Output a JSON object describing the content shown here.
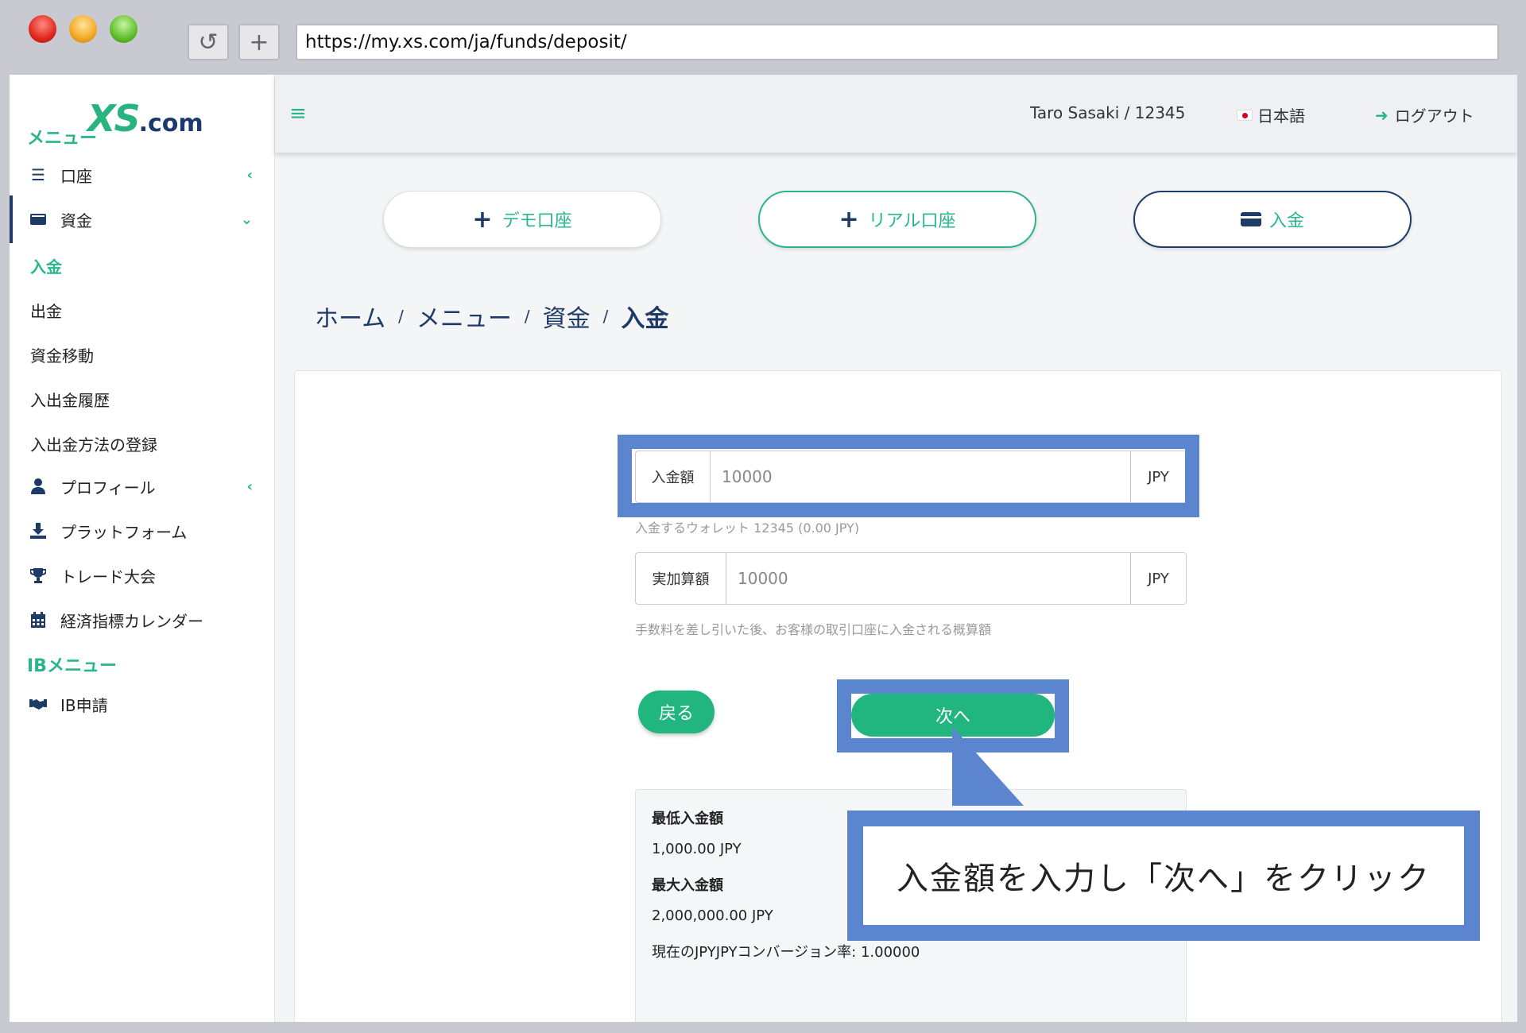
{
  "browser": {
    "url": "https://my.xs.com/ja/funds/deposit/",
    "reload_label": "↺",
    "newtab_label": "+"
  },
  "logo": {
    "xs": "XS",
    "com": ".com"
  },
  "sidebar": {
    "menu_heading": "メニュー",
    "items": [
      {
        "label": "口座",
        "icon": "list-icon"
      },
      {
        "label": "資金",
        "icon": "wallet-icon"
      },
      {
        "label": "プロフィール",
        "icon": "user-icon"
      },
      {
        "label": "プラットフォーム",
        "icon": "download-icon"
      },
      {
        "label": "トレード大会",
        "icon": "trophy-icon"
      },
      {
        "label": "経済指標カレンダー",
        "icon": "calendar-icon"
      }
    ],
    "funds_sub": [
      "入金",
      "出金",
      "資金移動",
      "入出金履歴",
      "入出金方法の登録"
    ],
    "ib_heading": "IBメニュー",
    "ib_items": [
      {
        "label": "IB申請",
        "icon": "handshake-icon"
      }
    ]
  },
  "header": {
    "menu_icon": "hamburger-icon",
    "user": "Taro Sasaki / 12345",
    "language": "日本語",
    "logout": "ログアウト"
  },
  "actions": {
    "demo": "デモ口座",
    "real": "リアル口座",
    "deposit": "入金"
  },
  "breadcrumb": [
    "ホーム",
    "メニュー",
    "資金",
    "入金"
  ],
  "form": {
    "amount_label": "入金額",
    "amount_value": "10000",
    "amount_unit": "JPY",
    "amount_hint": "入金するウォレット 12345 (0.00 JPY)",
    "actual_label": "実加算額",
    "actual_value": "10000",
    "actual_unit": "JPY",
    "actual_hint": "手数料を差し引いた後、お客様の取引口座に入金される概算額",
    "back_label": "戻る",
    "next_label": "次へ"
  },
  "limits": {
    "min_title": "最低入金額",
    "min_value": "1,000.00 JPY",
    "max_title": "最大入金額",
    "max_value": "2,000,000.00 JPY",
    "rate": "現在のJPYJPYコンバージョン率: 1.00000"
  },
  "callout": {
    "text": "入金額を入力し「次へ」をクリック"
  },
  "colors": {
    "accent": "#2bb58c",
    "navy": "#1e3a66",
    "highlight": "#5b86cf",
    "button": "#21b67f"
  }
}
